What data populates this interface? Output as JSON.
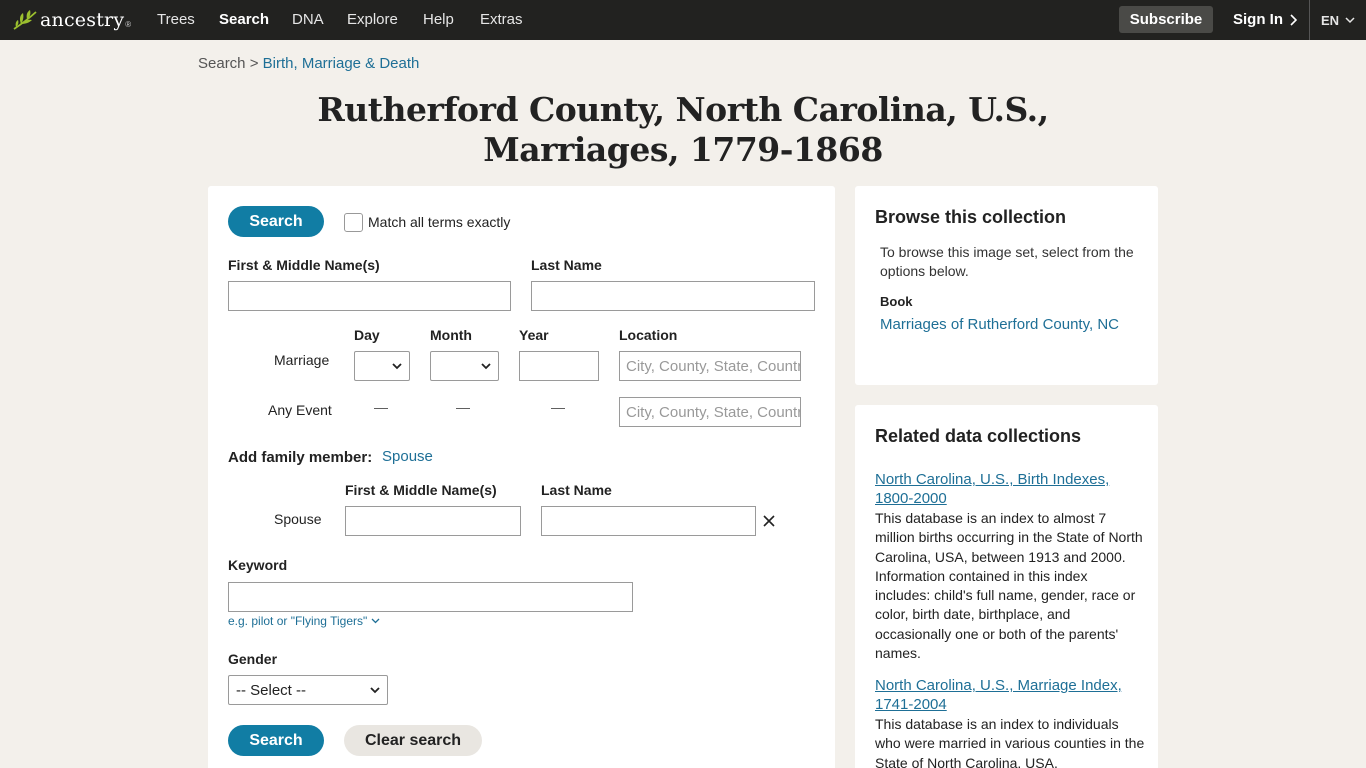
{
  "nav": {
    "logo_text": "ancestry",
    "logo_tm": "®",
    "links": [
      "Trees",
      "Search",
      "DNA",
      "Explore",
      "Help",
      "Extras"
    ],
    "subscribe": "Subscribe",
    "signin": "Sign In",
    "lang": "EN"
  },
  "breadcrumb": {
    "root": "Search",
    "sep": ">",
    "current": "Birth, Marriage & Death"
  },
  "title": {
    "line1": "Rutherford County, North Carolina, U.S.,",
    "line2": "Marriages, 1779-1868"
  },
  "search": {
    "search_button": "Search",
    "match_exact": "Match all terms exactly",
    "first_name_label": "First & Middle Name(s)",
    "last_name_label": "Last Name",
    "col_day": "Day",
    "col_month": "Month",
    "col_year": "Year",
    "col_location": "Location",
    "row_marriage": "Marriage",
    "row_any_event": "Any Event",
    "dash": "—",
    "location_placeholder": "City, County, State, Country",
    "add_family_label": "Add family member:",
    "add_family_link": "Spouse",
    "spouse_first_label": "First & Middle Name(s)",
    "spouse_last_label": "Last Name",
    "spouse_row_label": "Spouse",
    "keyword_label": "Keyword",
    "keyword_hint": "e.g. pilot or \"Flying Tigers\"",
    "gender_label": "Gender",
    "gender_value": "-- Select --",
    "bottom_search_button": "Search",
    "clear_button": "Clear search"
  },
  "browse": {
    "heading": "Browse this collection",
    "text": "To browse this image set, select from the options below.",
    "book_label": "Book",
    "book_link": "Marriages of Rutherford County, NC"
  },
  "related": {
    "heading": "Related data collections",
    "items": [
      {
        "title": "North Carolina, U.S., Birth Indexes, 1800-2000",
        "desc": "This database is an index to almost 7 million births occurring in the State of North Carolina, USA, between 1913 and 2000. Information contained in this index includes: child's full name, gender, race or color, birth date, birthplace, and occasionally one or both of the parents' names."
      },
      {
        "title": "North Carolina, U.S., Marriage Index, 1741-2004",
        "desc": "This database is an index to individuals who were married in various counties in the State of North Carolina, USA."
      }
    ]
  }
}
